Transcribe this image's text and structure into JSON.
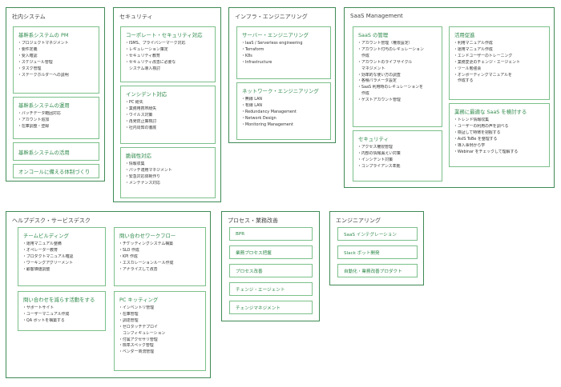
{
  "sections": {
    "shanai": {
      "title": "社内システム",
      "pm": {
        "title": "基幹系システムの PM",
        "items": [
          "・プロジェクトマネジメント",
          "・要件定義",
          "・受入確認",
          "・スケジュール管理",
          "・タスク管理",
          "・ステークホルダーへの説明"
        ]
      },
      "unyo": {
        "title": "基幹系システムの運用",
        "items": [
          "・バッチデータ範囲対応",
          "・アカウント追加",
          "・在庫調整・登録"
        ]
      },
      "shiyo": {
        "title": "基幹系システムの活用"
      },
      "oncall": {
        "title": "オンコールに備える体制づくり"
      }
    },
    "security": {
      "title": "セキュリティ",
      "corporate": {
        "title": "コーポレート・セキュリティ対応",
        "items": [
          "・ISMS、プライバシーマーク対応",
          "・レギュレーション策定",
          "・セキュリティ教育",
          "・セキュリティ改善に必要な",
          "システム導入検討"
        ]
      },
      "incident": {
        "title": "インシデント対応",
        "items": [
          "・PC 紛失",
          "・業務用携帯紛失",
          "・ウイルス対策",
          "・再発防止策検討",
          "・社内周知の徹底"
        ]
      },
      "vuln": {
        "title": "脆弱性対応",
        "items": [
          "・情報収集",
          "・パッチ適用マネジメント",
          "・緊急対応体制作り",
          "・メンテナンス対応"
        ]
      }
    },
    "infra": {
      "title": "インフラ・エンジニアリング",
      "server": {
        "title": "サーバー・エンジニアリング",
        "items": [
          "・IaaS / Serverless engineering",
          "・Terraform",
          "・K8s",
          "・Infrastructure"
        ]
      },
      "network": {
        "title": "ネットワーク・エンジニアリング",
        "items": [
          "・無線 LAN",
          "・有線 LAN",
          "・Redundancy Management",
          "・Network Design",
          "・Monitoring Management"
        ]
      }
    },
    "saas": {
      "title": "SaaS Management",
      "kanri": {
        "title": "SaaS の管理",
        "items": [
          "・アカウント管理（権限設定）",
          "・アカウント付与のレギュレーション",
          "作成",
          "・アカウントのライフサイクル",
          "マネジメント",
          "・効率的な使い方の調査",
          "・各種パラメータ設定",
          "・SaaS 利用時のレギュレーションを",
          "作成",
          "・ゲストアカウント管理"
        ]
      },
      "security": {
        "title": "セキュリティ",
        "items": [
          "・アクセス権限管理",
          "・内部の情報漏えい対策",
          "・インシデント対策",
          "・コンプライアンス準拠"
        ]
      },
      "katsuyo": {
        "title": "活用促進",
        "items": [
          "・利用マニュアル作成",
          "・運用マニュアル作成",
          "・エンドユーザーのトレーニング",
          "・業務変更のチェンジ・エージェント",
          "・ツール勉強会",
          "・オンボーディングマニュアルを",
          "作成する"
        ]
      },
      "kento": {
        "title": "業務に最適な SaaS を検討する",
        "items": [
          "・トレンド情報収集",
          "・ユーザーの利用の声を調べる",
          "・検証して特徴を把握する",
          "・AsIS ToBe を整理する",
          "・導入事例から学",
          "・Webinar をチェックして理解する"
        ]
      }
    },
    "helpdesk": {
      "title": "ヘルプデスク・サービスデスク",
      "team": {
        "title": "チームビルディング",
        "items": [
          "・運用マニュアル整備",
          "・オペレーター教育",
          "・プロダクトマニュアル確認",
          "・ワーキングアグリーメント",
          "・顧客価値調整"
        ]
      },
      "workflow": {
        "title": "問い合わせワークフロー",
        "items": [
          "・チケッティングシステム構築",
          "・SLO 作成",
          "・KPI 作成",
          "・エスカレーションルール作成",
          "・アナライズして改善"
        ]
      },
      "reduce": {
        "title": "問い合わせを減らす活動をする",
        "items": [
          "・サポートサイト",
          "・ユーザーマニュアル作成",
          "・QA ボットを構築する"
        ]
      },
      "kitting": {
        "title": "PC キッティング",
        "items": [
          "・インベントリ管理",
          "・在庫管理",
          "・調達管理",
          "・ゼロタッチデプロイ",
          "コンフィギュレーション",
          "・付属アクセサリ管理",
          "・標準スペック管理",
          "・ベンダー商流管理"
        ]
      }
    },
    "process": {
      "title": "プロセス・業務改善",
      "items": [
        "BPR",
        "業務プロセス把握",
        "プロセス改善",
        "チェンジ・エージェント",
        "チェンジマネジメント"
      ]
    },
    "engineering": {
      "title": "エンジニアリング",
      "items": [
        "SaaS インテグレーション",
        "Slack ボット開発",
        "自動化・業務改善プロダクト"
      ]
    }
  }
}
